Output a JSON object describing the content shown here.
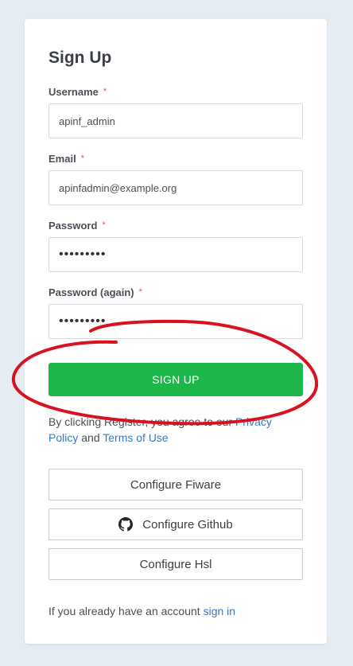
{
  "form": {
    "title": "Sign Up",
    "username": {
      "label": "Username",
      "required_mark": "*",
      "value": "apinf_admin"
    },
    "email": {
      "label": "Email",
      "required_mark": "*",
      "value": "apinfadmin@example.org"
    },
    "password": {
      "label": "Password",
      "required_mark": "*",
      "value": "•••••••••"
    },
    "password_again": {
      "label": "Password (again)",
      "required_mark": "*",
      "value": "•••••••••"
    },
    "submit_label": "SIGN UP",
    "terms": {
      "prefix": "By clicking Register, you agree to our ",
      "privacy_link": "Privacy Policy",
      "middle": " and ",
      "terms_link": "Terms of Use"
    }
  },
  "oauth": {
    "fiware_label": "Configure Fiware",
    "github_label": "Configure Github",
    "github_icon": "github-icon",
    "hsl_label": "Configure Hsl"
  },
  "footer": {
    "prefix": "If you already have an account ",
    "signin_link": "sign in"
  },
  "colors": {
    "background": "#e6ecf3",
    "primary_button": "#1db64a",
    "link": "#3a78c2",
    "required": "#d9534f",
    "annotation": "#d8121f"
  }
}
